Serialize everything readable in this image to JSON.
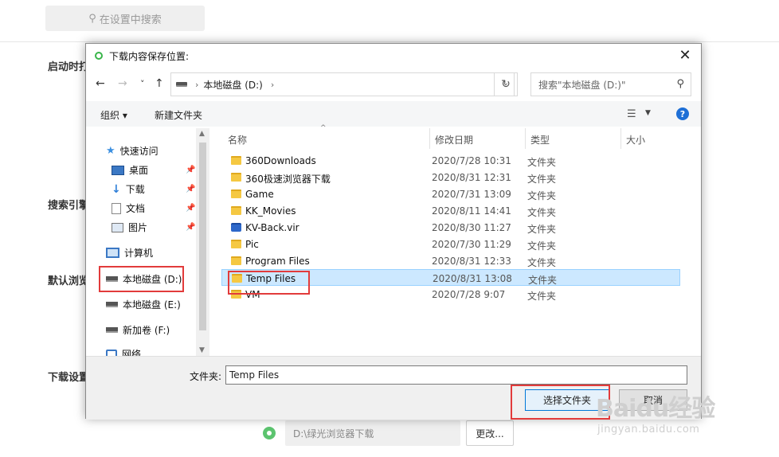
{
  "background": {
    "search_placeholder": "在设置中搜索",
    "labels": [
      "启动时打",
      "搜索引擎",
      "默认浏览",
      "下载设置"
    ],
    "download_path": "D:\\绿光浏览器下载",
    "change_button": "更改..."
  },
  "dialog": {
    "title": "下载内容保存位置:",
    "nav": {
      "back": "←",
      "forward": "→",
      "recent": "˅",
      "up": "↑",
      "address_path": "本地磁盘 (D:)",
      "refresh": "↻",
      "search_placeholder": "搜索\"本地磁盘 (D:)\""
    },
    "toolbar": {
      "organize": "组织 ▾",
      "new_folder": "新建文件夹",
      "help": "?"
    },
    "sidebar": {
      "items": [
        {
          "label": "快速访问"
        },
        {
          "label": "桌面"
        },
        {
          "label": "下载"
        },
        {
          "label": "文档"
        },
        {
          "label": "图片"
        },
        {
          "label": "计算机"
        },
        {
          "label": "本地磁盘 (D:)"
        },
        {
          "label": "本地磁盘 (E:)"
        },
        {
          "label": "新加卷 (F:)"
        },
        {
          "label": "网络"
        }
      ]
    },
    "columns": {
      "name": "名称",
      "modified": "修改日期",
      "type": "类型",
      "size": "大小"
    },
    "files": [
      {
        "name": "360Downloads",
        "date": "2020/7/28 10:31",
        "type": "文件夹"
      },
      {
        "name": "360极速浏览器下载",
        "date": "2020/8/31 12:31",
        "type": "文件夹"
      },
      {
        "name": "Game",
        "date": "2020/7/31 13:09",
        "type": "文件夹"
      },
      {
        "name": "KK_Movies",
        "date": "2020/8/11 14:41",
        "type": "文件夹"
      },
      {
        "name": "KV-Back.vir",
        "date": "2020/8/30 11:27",
        "type": "文件夹"
      },
      {
        "name": "Pic",
        "date": "2020/7/30 11:29",
        "type": "文件夹"
      },
      {
        "name": "Program Files",
        "date": "2020/8/31 12:33",
        "type": "文件夹"
      },
      {
        "name": "Temp Files",
        "date": "2020/8/31 13:08",
        "type": "文件夹"
      },
      {
        "name": "VM",
        "date": "2020/7/28 9:07",
        "type": "文件夹"
      }
    ],
    "folder_label": "文件夹:",
    "folder_value": "Temp Files",
    "select_button": "选择文件夹",
    "cancel_button": "取消"
  },
  "watermark": {
    "logo": "Baidu经验",
    "url": "jingyan.baidu.com"
  },
  "colors": {
    "selection": "#cce8ff",
    "accent": "#0078d7",
    "annotation": "#e23b3b",
    "radio": "#5cc46f"
  }
}
